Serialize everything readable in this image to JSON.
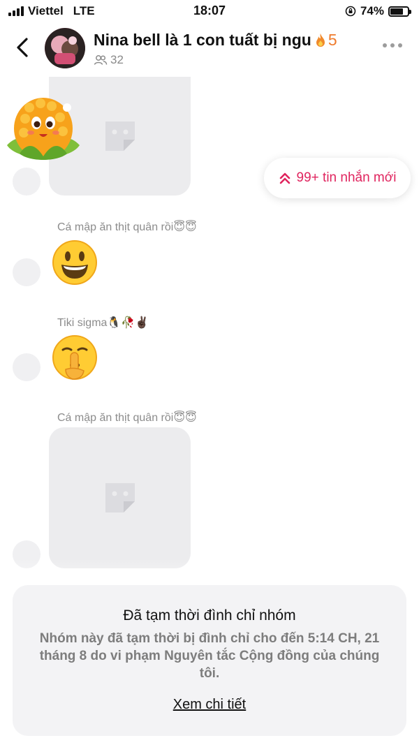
{
  "status_bar": {
    "carrier": "Viettel",
    "network": "LTE",
    "time": "18:07",
    "battery_percent": "74%",
    "battery_level": 0.74
  },
  "header": {
    "group_name": "Nina bell là 1 con tuất bị ngu",
    "streak_count": "5",
    "member_count": "32",
    "icons": {
      "back": "chevron-left-icon",
      "streak": "fire-icon",
      "members": "people-icon",
      "more": "ellipsis-icon"
    }
  },
  "messages": [
    {
      "type": "sticker",
      "sender": ""
    },
    {
      "type": "emoji",
      "sender": "Cá mập ăn thịt quân rồi😇😇",
      "emoji": "😃"
    },
    {
      "type": "emoji",
      "sender": "Tiki sigma🐧🥀✌🏿",
      "emoji": "🤫"
    },
    {
      "type": "sticker",
      "sender": "Cá mập ăn thịt quân rồi😇😇"
    }
  ],
  "new_messages_pill": {
    "label": "99+ tin nhắn mới"
  },
  "suspension": {
    "title": "Đã tạm thời đình chỉ nhóm",
    "body": "Nhóm này đã tạm thời bị đình chỉ cho đến 5:14 CH, 21 tháng 8 do vi phạm Nguyên tắc Cộng đồng của chúng tôi.",
    "link": "Xem chi tiết"
  },
  "colors": {
    "accent": "#e0245e",
    "streak": "#ef7b2c",
    "muted": "#8c8c8c"
  }
}
